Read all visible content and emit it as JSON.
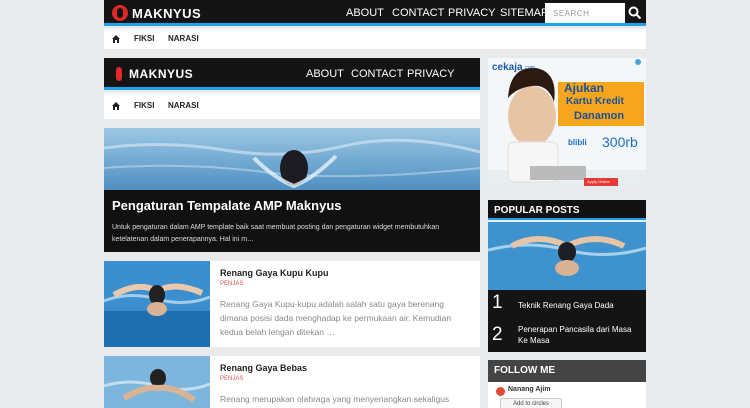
{
  "header": {
    "logo_text": "MAKNYUS",
    "nav": [
      "ABOUT",
      "CONTACT",
      "PRIVACY",
      "SITEMAP"
    ],
    "search_placeholder": "SEARCH"
  },
  "subnav": [
    "FIKSI",
    "NARASI"
  ],
  "preview": {
    "logo_text": "MAKNYUS",
    "nav": [
      "ABOUT",
      "CONTACT",
      "PRIVACY"
    ],
    "subnav": [
      "FIKSI",
      "NARASI"
    ]
  },
  "featured": {
    "title": "Pengaturan Tempalate AMP Maknyus",
    "description": "Untuk pengaturan dalam AMP template baik saat membuat posting dan pengaturan widget membutuhkan ketelatenan dalam penerapannya. Hal ini m…"
  },
  "posts": [
    {
      "title": "Renang Gaya Kupu Kupu",
      "category": "PENJAS",
      "description": "Renang Gaya Kupu-kupu adalah salah satu gaya berenang dimana posisi dada menghadap ke permukaan air. Kemudian kedua belah lengan ditekan …"
    },
    {
      "title": "Renang Gaya Bebas",
      "category": "PENJAS",
      "description": "Renang merupakan olahraga yang menyenangkan sekaligus"
    }
  ],
  "ad": {
    "brand": "cekaja",
    "brand_suffix": ".com",
    "headline1": "Ajukan",
    "headline2": "Kartu Kredit",
    "headline3": "Danamon",
    "partner": "blibli",
    "amount": "300rb",
    "cta": "Apply Online"
  },
  "popular": {
    "heading": "POPULAR POSTS",
    "items": [
      {
        "num": "1",
        "title": "Teknik Renang Gaya Dada"
      },
      {
        "num": "2",
        "title": "Penerapan Pancasila dari Masa Ke Masa"
      }
    ]
  },
  "follow": {
    "heading": "FOLLOW ME",
    "name": "Nanang Ajim",
    "button": "Add to circles"
  }
}
